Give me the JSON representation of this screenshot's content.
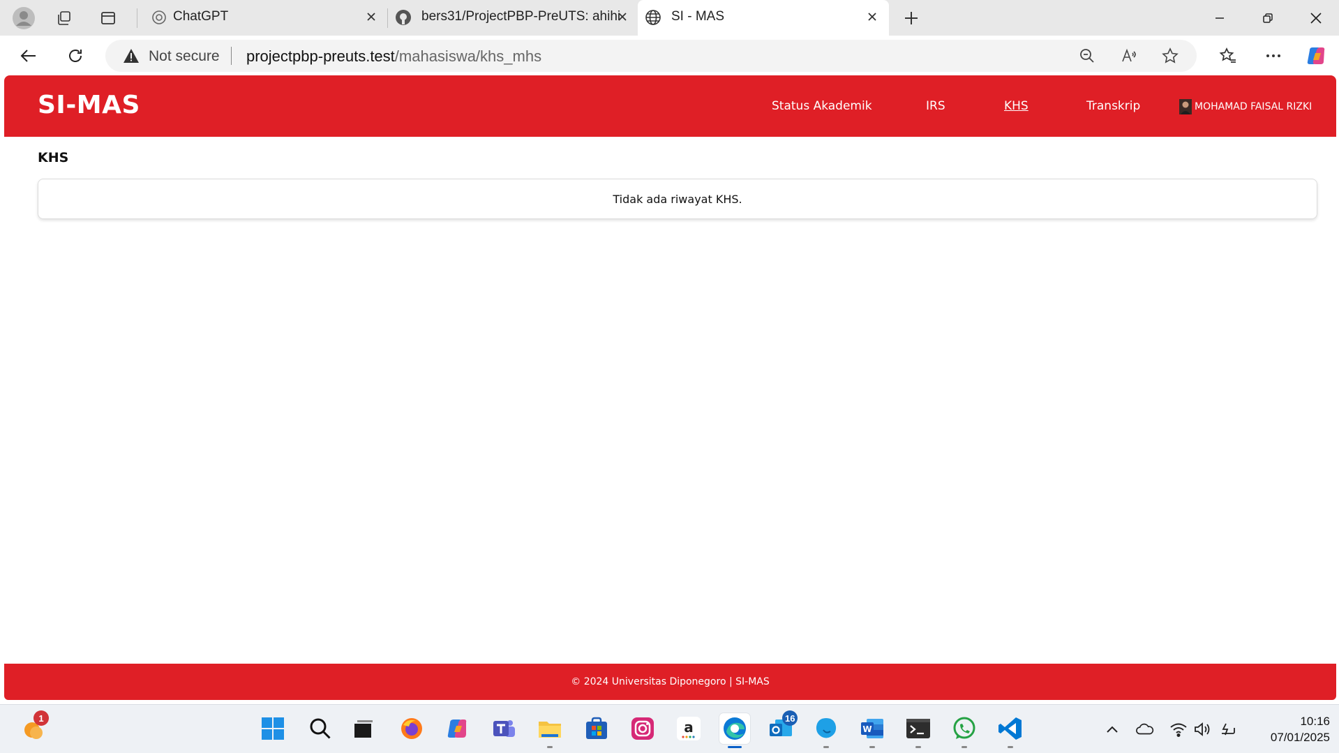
{
  "browser": {
    "tabs": [
      {
        "label": "ChatGPT",
        "favicon": "chatgpt-icon",
        "active": false
      },
      {
        "label": "bers31/ProjectPBP-PreUTS: ahihi",
        "favicon": "github-icon",
        "active": false
      },
      {
        "label": "SI - MAS",
        "favicon": "globe-icon",
        "active": true
      }
    ],
    "security_label": "Not secure",
    "url_host": "projectpbp-preuts.test",
    "url_path": "/mahasiswa/khs_mhs"
  },
  "app": {
    "brand": "SI-MAS",
    "nav": {
      "status_akademik": "Status Akademik",
      "irs": "IRS",
      "khs": "KHS",
      "transkrip": "Transkrip",
      "user_name": "MOHAMAD FAISAL RIZKI"
    },
    "page_title": "KHS",
    "empty_message": "Tidak ada riwayat KHS.",
    "footer": "© 2024 Universitas Diponegoro | SI-MAS",
    "colors": {
      "primary": "#df1f26",
      "text": "#111111",
      "background": "#ffffff"
    }
  },
  "taskbar": {
    "apps": [
      "windows-start-icon",
      "search-icon",
      "task-view-icon",
      "firefox-icon",
      "copilot-icon",
      "teams-icon",
      "file-explorer-icon",
      "microsoft-store-icon",
      "instagram-icon",
      "amazon-icon",
      "edge-icon",
      "outlook-icon",
      "blue-app-icon",
      "word-icon",
      "terminal-icon",
      "whatsapp-icon",
      "vscode-icon"
    ],
    "weather_badge": "1",
    "outlook_badge": "16",
    "time": "10:16",
    "date": "07/01/2025"
  }
}
